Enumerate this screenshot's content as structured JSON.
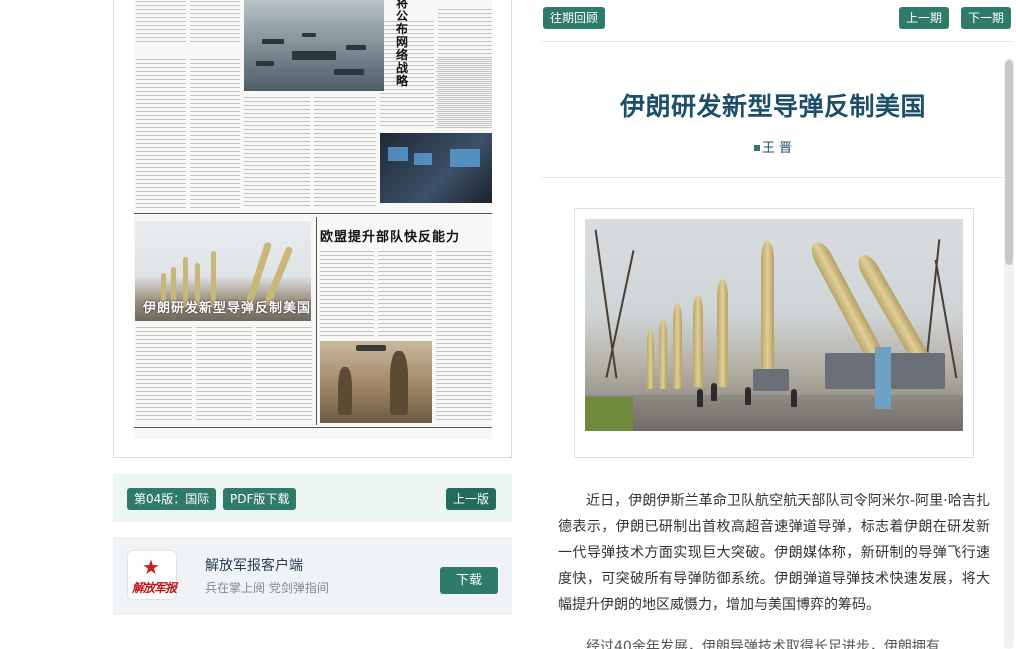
{
  "left": {
    "newspaper": {
      "caption": "伊朗研发新型导弹反制美国",
      "headline": "欧盟提升部队快反能力",
      "vertical_headline": "将公布 网络战略"
    },
    "version_bar": {
      "edition_label": "第04版：国际",
      "pdf_label": "PDF版下载",
      "prev_edition_label": "上一版"
    },
    "app_promo": {
      "logo_text": "解放军报",
      "title": "解放军报客户端",
      "subtitle": "兵在掌上阅 党剑弹指间",
      "download_label": "下载"
    }
  },
  "right": {
    "nav": {
      "archive_label": "往期回顾",
      "prev_issue_label": "上一期",
      "next_issue_label": "下一期"
    },
    "article": {
      "title": "伊朗研发新型导弹反制美国",
      "author": "王 晋",
      "paragraphs": [
        "近日，伊朗伊斯兰革命卫队航空航天部队司令阿米尔-阿里·哈吉扎德表示，伊朗已研制出首枚高超音速弹道导弹，标志着伊朗在研发新一代导弹技术方面实现巨大突破。伊朗媒体称，新研制的导弹飞行速度快，可突破所有导弹防御系统。伊朗弹道导弹技术快速发展，将大幅提升伊朗的地区威慑力，增加与美国博弈的筹码。",
        "经过40余年发展，伊朗导弹技术取得长足进步，伊朗拥有"
      ]
    }
  },
  "colors": {
    "accent": "#2f7a68",
    "title": "#1e4f68"
  }
}
